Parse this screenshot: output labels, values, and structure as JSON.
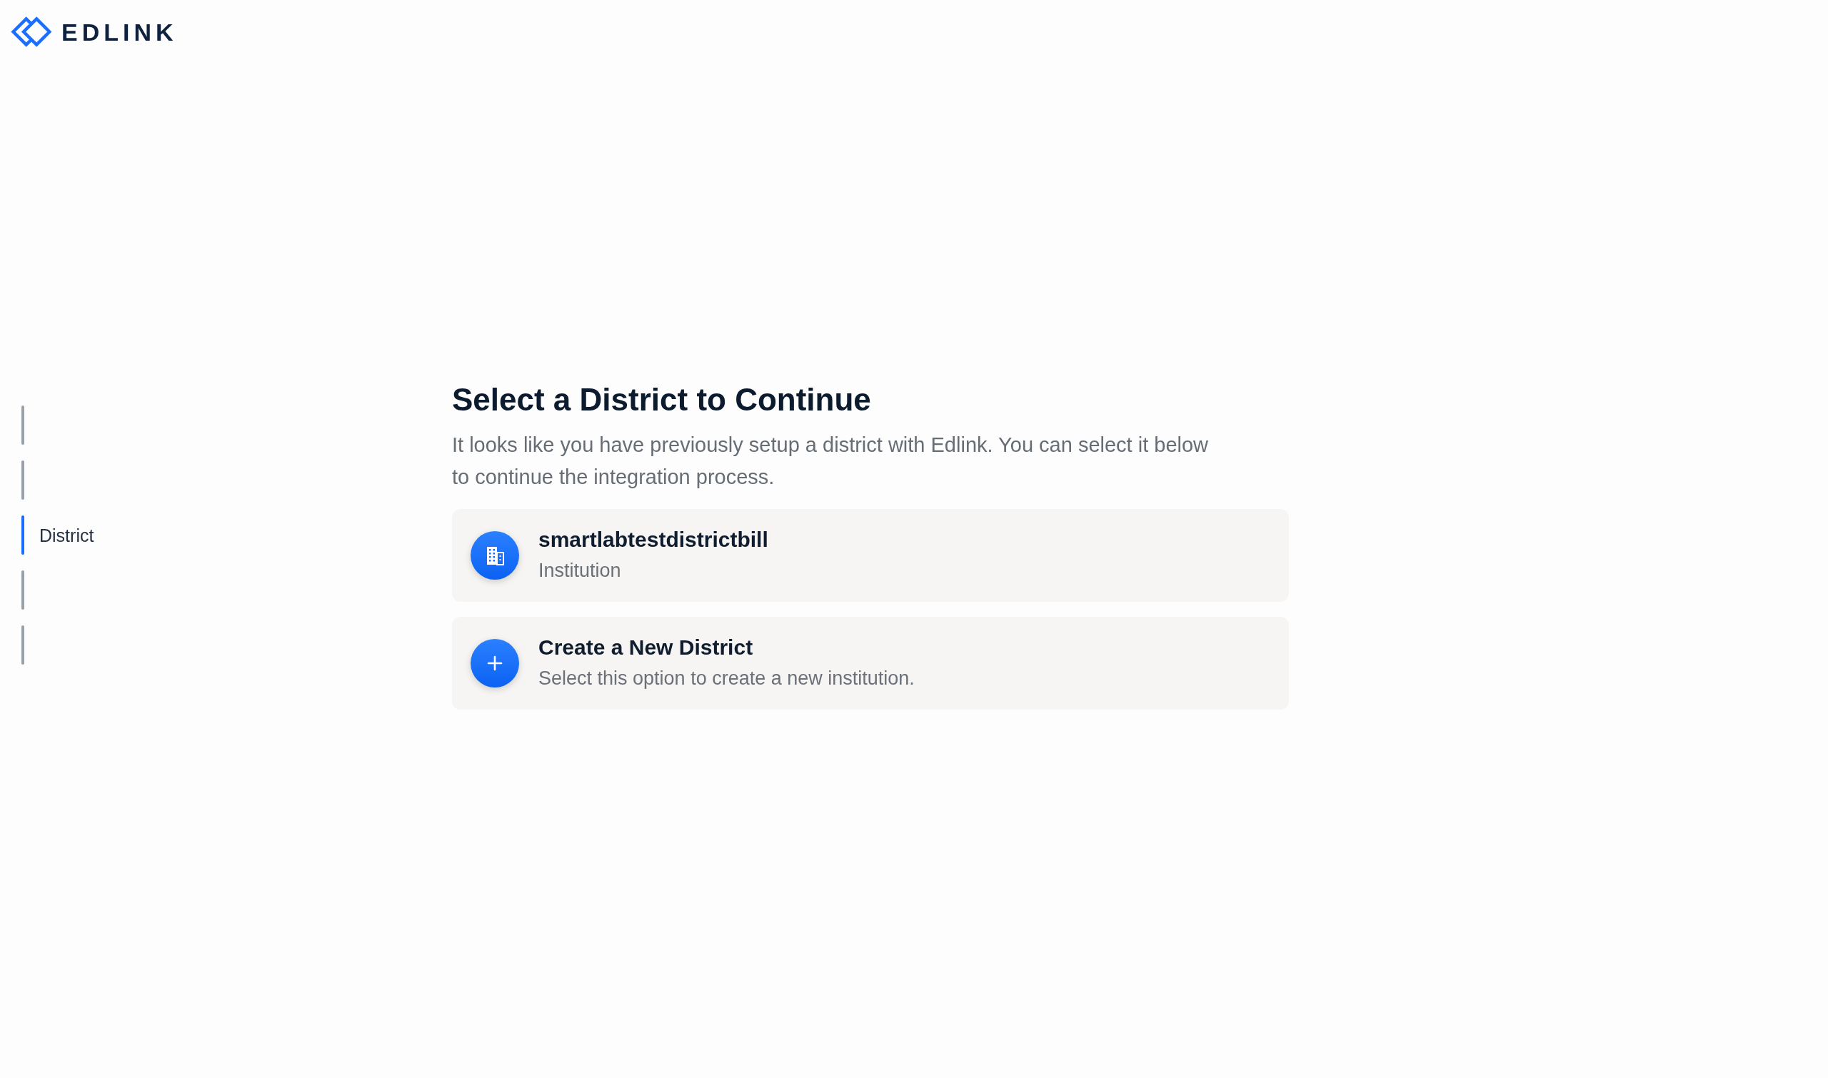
{
  "logo": {
    "text": "EDLINK"
  },
  "sidebar": {
    "steps": [
      {
        "selected": false
      },
      {
        "selected": false
      },
      {
        "label": "District",
        "selected": true
      },
      {
        "selected": false
      },
      {
        "selected": false
      }
    ]
  },
  "main": {
    "title": "Select a District to Continue",
    "description": "It looks like you have previously setup a district with Edlink. You can select it below to continue the integration process.",
    "options": [
      {
        "kind": "existing",
        "title": "smartlabtestdistrictbill",
        "subtitle": "Institution"
      },
      {
        "kind": "create",
        "title": "Create a New District",
        "subtitle": "Select this option to create a new institution."
      }
    ]
  }
}
